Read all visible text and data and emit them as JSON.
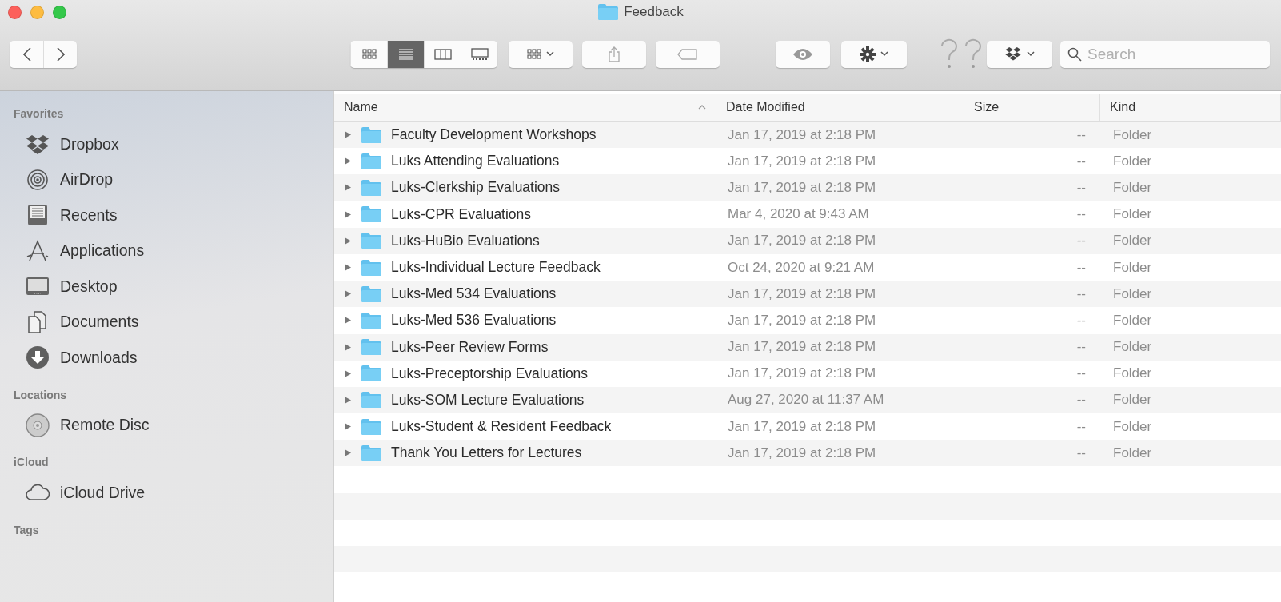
{
  "window": {
    "title": "Feedback"
  },
  "toolbar": {
    "view_modes": [
      {
        "kind": "icons",
        "selected": false
      },
      {
        "kind": "list",
        "selected": true
      },
      {
        "kind": "columns",
        "selected": false
      },
      {
        "kind": "gallery",
        "selected": false
      }
    ],
    "search": {
      "placeholder": "Search"
    }
  },
  "sidebar": {
    "sections": [
      {
        "title": "Favorites",
        "items": [
          {
            "label": "Dropbox",
            "kind": "dropbox"
          },
          {
            "label": "AirDrop",
            "kind": "airdrop"
          },
          {
            "label": "Recents",
            "kind": "recents"
          },
          {
            "label": "Applications",
            "kind": "applications"
          },
          {
            "label": "Desktop",
            "kind": "desktop"
          },
          {
            "label": "Documents",
            "kind": "documents"
          },
          {
            "label": "Downloads",
            "kind": "downloads"
          }
        ]
      },
      {
        "title": "Locations",
        "items": [
          {
            "label": "Remote Disc",
            "kind": "disc"
          }
        ]
      },
      {
        "title": "iCloud",
        "items": [
          {
            "label": "iCloud Drive",
            "kind": "cloud"
          }
        ]
      },
      {
        "title": "Tags"
      }
    ]
  },
  "table": {
    "columns": [
      {
        "label": "Name",
        "sorted": true
      },
      {
        "label": "Date Modified",
        "sorted": false
      },
      {
        "label": "Size",
        "sorted": false
      },
      {
        "label": "Kind",
        "sorted": false
      }
    ],
    "rows": [
      {
        "name": "Faculty Development Workshops",
        "date": "Jan 17, 2019 at 2:18 PM",
        "size": "--",
        "kind": "Folder",
        "expanded": false
      },
      {
        "name": "Luks Attending Evaluations",
        "date": "Jan 17, 2019 at 2:18 PM",
        "size": "--",
        "kind": "Folder",
        "expanded": false
      },
      {
        "name": "Luks-Clerkship Evaluations",
        "date": "Jan 17, 2019 at 2:18 PM",
        "size": "--",
        "kind": "Folder",
        "expanded": false
      },
      {
        "name": "Luks-CPR Evaluations",
        "date": "Mar 4, 2020 at 9:43 AM",
        "size": "--",
        "kind": "Folder",
        "expanded": false
      },
      {
        "name": "Luks-HuBio Evaluations",
        "date": "Jan 17, 2019 at 2:18 PM",
        "size": "--",
        "kind": "Folder",
        "expanded": false
      },
      {
        "name": "Luks-Individual Lecture Feedback",
        "date": "Oct 24, 2020 at 9:21 AM",
        "size": "--",
        "kind": "Folder",
        "expanded": false
      },
      {
        "name": "Luks-Med 534 Evaluations",
        "date": "Jan 17, 2019 at 2:18 PM",
        "size": "--",
        "kind": "Folder",
        "expanded": false
      },
      {
        "name": "Luks-Med 536 Evaluations",
        "date": "Jan 17, 2019 at 2:18 PM",
        "size": "--",
        "kind": "Folder",
        "expanded": false
      },
      {
        "name": "Luks-Peer Review Forms",
        "date": "Jan 17, 2019 at 2:18 PM",
        "size": "--",
        "kind": "Folder",
        "expanded": false
      },
      {
        "name": "Luks-Preceptorship Evaluations",
        "date": "Jan 17, 2019 at 2:18 PM",
        "size": "--",
        "kind": "Folder",
        "expanded": false
      },
      {
        "name": "Luks-SOM Lecture Evaluations",
        "date": "Aug 27, 2020 at 11:37 AM",
        "size": "--",
        "kind": "Folder",
        "expanded": false
      },
      {
        "name": "Luks-Student & Resident Feedback",
        "date": "Jan 17, 2019 at 2:18 PM",
        "size": "--",
        "kind": "Folder",
        "expanded": false
      },
      {
        "name": "Thank You Letters for Lectures",
        "date": "Jan 17, 2019 at 2:18 PM",
        "size": "--",
        "kind": "Folder",
        "expanded": false
      }
    ]
  }
}
